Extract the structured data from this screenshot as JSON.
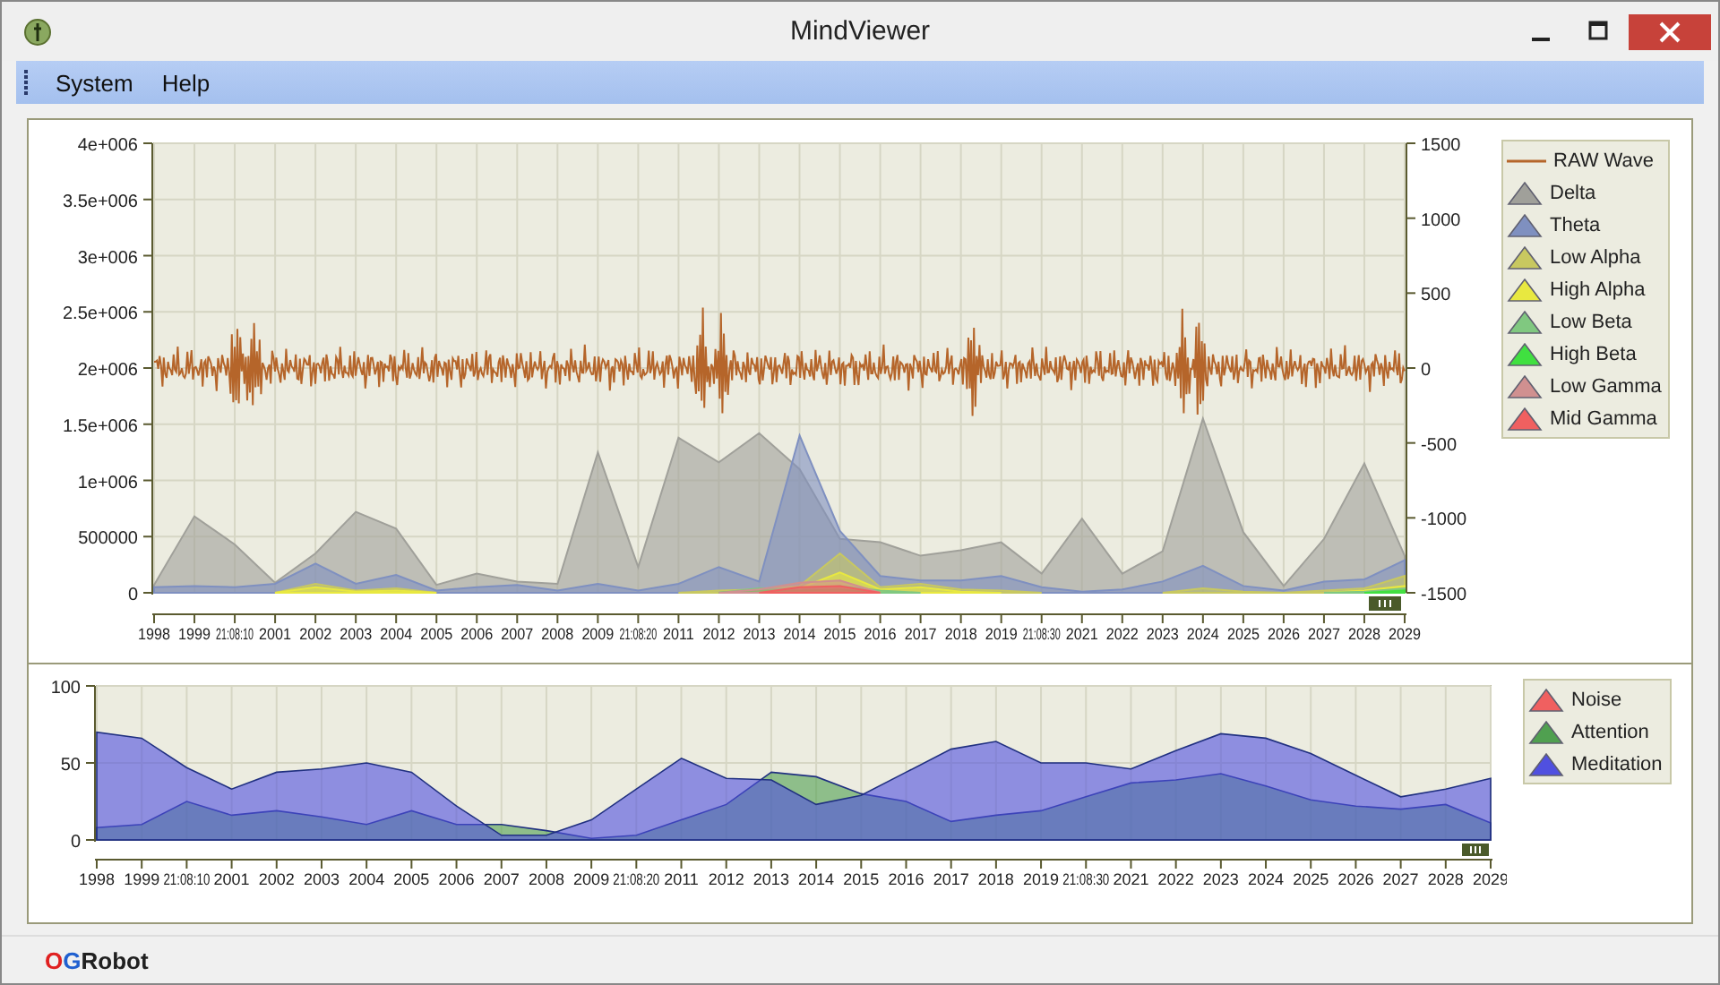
{
  "window": {
    "title": "MindViewer"
  },
  "menu": [
    "System",
    "Help"
  ],
  "top_chart": {
    "raw_wave": {
      "name": "RAW Wave",
      "color": "#b5652a"
    },
    "y2ticks": [
      "1500",
      "1000",
      "500",
      "0",
      "-500",
      "-1000",
      "-1500"
    ],
    "chart_data": {
      "type": "area",
      "grid": true,
      "categories": [
        "1998",
        "1999",
        "21:08:10",
        "2001",
        "2002",
        "2003",
        "2004",
        "2005",
        "2006",
        "2007",
        "2008",
        "2009",
        "21:08:20",
        "2011",
        "2012",
        "2013",
        "2014",
        "2015",
        "2016",
        "2017",
        "2018",
        "2019",
        "21:08:30",
        "2021",
        "2022",
        "2023",
        "2024",
        "2025",
        "2026",
        "2027",
        "2028",
        "2029"
      ],
      "ylim": [
        0,
        4000000
      ],
      "yticks": [
        0,
        500000,
        {
          "value": 1000000,
          "label": "1e+006"
        },
        {
          "value": 1500000,
          "label": "1.5e+006"
        },
        {
          "value": 2000000,
          "label": "2e+006"
        },
        {
          "value": 2500000,
          "label": "2.5e+006"
        },
        {
          "value": 3000000,
          "label": "3e+006"
        },
        {
          "value": 3500000,
          "label": "3.5e+006"
        },
        {
          "value": 4000000,
          "label": "4e+006"
        }
      ],
      "series": [
        {
          "name": "Delta",
          "color": "#a0a09a",
          "values": [
            70000,
            680000,
            430000,
            90000,
            350000,
            720000,
            570000,
            70000,
            170000,
            100000,
            80000,
            1250000,
            230000,
            1380000,
            1160000,
            1420000,
            1100000,
            480000,
            450000,
            330000,
            380000,
            450000,
            170000,
            660000,
            170000,
            370000,
            1550000,
            540000,
            60000,
            480000,
            1150000,
            330000
          ]
        },
        {
          "name": "Theta",
          "color": "#7f90c0",
          "values": [
            50000,
            60000,
            50000,
            80000,
            260000,
            80000,
            160000,
            20000,
            50000,
            70000,
            20000,
            80000,
            20000,
            80000,
            230000,
            100000,
            1400000,
            550000,
            150000,
            110000,
            110000,
            150000,
            50000,
            10000,
            30000,
            100000,
            240000,
            60000,
            20000,
            100000,
            120000,
            290000
          ]
        },
        {
          "name": "Low Alpha",
          "color": "#c8c860",
          "values": [
            null,
            null,
            null,
            0,
            80000,
            20000,
            40000,
            0,
            null,
            null,
            null,
            null,
            null,
            0,
            20000,
            30000,
            60000,
            350000,
            50000,
            80000,
            30000,
            20000,
            0,
            null,
            null,
            0,
            40000,
            10000,
            0,
            20000,
            40000,
            150000
          ]
        },
        {
          "name": "High Alpha",
          "color": "#e8e840",
          "values": [
            null,
            null,
            null,
            0,
            50000,
            10000,
            20000,
            0,
            null,
            null,
            null,
            null,
            null,
            null,
            null,
            0,
            40000,
            180000,
            30000,
            50000,
            10000,
            0,
            null,
            null,
            null,
            null,
            null,
            null,
            null,
            0,
            20000,
            60000
          ]
        },
        {
          "name": "Low Beta",
          "color": "#80c880",
          "values": [
            null,
            null,
            null,
            null,
            null,
            null,
            null,
            null,
            null,
            null,
            null,
            null,
            null,
            null,
            0,
            40000,
            30000,
            60000,
            20000,
            0,
            null,
            null,
            null,
            null,
            null,
            null,
            null,
            null,
            null,
            0,
            10000,
            40000
          ]
        },
        {
          "name": "High Beta",
          "color": "#40e040",
          "values": [
            null,
            null,
            null,
            null,
            null,
            null,
            null,
            null,
            null,
            null,
            null,
            null,
            null,
            null,
            0,
            20000,
            20000,
            30000,
            0,
            null,
            null,
            null,
            null,
            null,
            null,
            null,
            null,
            null,
            null,
            null,
            0,
            20000
          ]
        },
        {
          "name": "Low Gamma",
          "color": "#d09090",
          "values": [
            null,
            null,
            null,
            null,
            null,
            null,
            null,
            null,
            null,
            null,
            null,
            null,
            null,
            null,
            0,
            30000,
            90000,
            110000,
            0,
            null,
            null,
            null,
            null,
            null,
            null,
            null,
            null,
            null,
            null,
            null,
            null,
            null
          ]
        },
        {
          "name": "Mid Gamma",
          "color": "#f06060",
          "values": [
            null,
            null,
            null,
            null,
            null,
            null,
            null,
            null,
            null,
            null,
            null,
            null,
            null,
            null,
            null,
            0,
            50000,
            60000,
            0,
            null,
            null,
            null,
            null,
            null,
            null,
            null,
            null,
            null,
            null,
            null,
            null,
            null
          ]
        }
      ]
    }
  },
  "bottom_chart": {
    "chart_data": {
      "type": "area",
      "grid": true,
      "categories": [
        "1998",
        "1999",
        "21:08:10",
        "2001",
        "2002",
        "2003",
        "2004",
        "2005",
        "2006",
        "2007",
        "2008",
        "2009",
        "21:08:20",
        "2011",
        "2012",
        "2013",
        "2014",
        "2015",
        "2016",
        "2017",
        "2018",
        "2019",
        "21:08:30",
        "2021",
        "2022",
        "2023",
        "2024",
        "2025",
        "2026",
        "2027",
        "2028",
        "2029"
      ],
      "ylim": [
        0,
        100
      ],
      "yticks": [
        0,
        50,
        100
      ],
      "series": [
        {
          "name": "Noise",
          "color": "#f06060",
          "values": [
            null,
            null,
            null,
            null,
            null,
            null,
            null,
            null,
            null,
            null,
            null,
            null,
            null,
            null,
            null,
            null,
            null,
            null,
            null,
            null,
            null,
            null,
            null,
            null,
            null,
            null,
            null,
            null,
            null,
            null,
            null,
            null
          ]
        },
        {
          "name": "Attention",
          "color": "#50a050",
          "values": [
            8,
            10,
            25,
            16,
            19,
            15,
            10,
            19,
            10,
            10,
            6,
            1,
            3,
            13,
            23,
            44,
            41,
            30,
            25,
            12,
            16,
            19,
            28,
            37,
            39,
            43,
            35,
            26,
            22,
            20,
            23,
            11
          ]
        },
        {
          "name": "Meditation",
          "color": "#5050e0",
          "values": [
            70,
            66,
            47,
            33,
            44,
            46,
            50,
            44,
            22,
            3,
            3,
            13,
            33,
            53,
            40,
            39,
            23,
            29,
            44,
            59,
            64,
            50,
            50,
            46,
            58,
            69,
            66,
            56,
            42,
            28,
            33,
            40
          ]
        }
      ]
    }
  },
  "status_bar": {
    "brand": [
      {
        "text": "O",
        "color": "#e02020"
      },
      {
        "text": "G",
        "color": "#2060d0"
      },
      {
        "text": "Robot",
        "color": "#202020"
      }
    ]
  }
}
